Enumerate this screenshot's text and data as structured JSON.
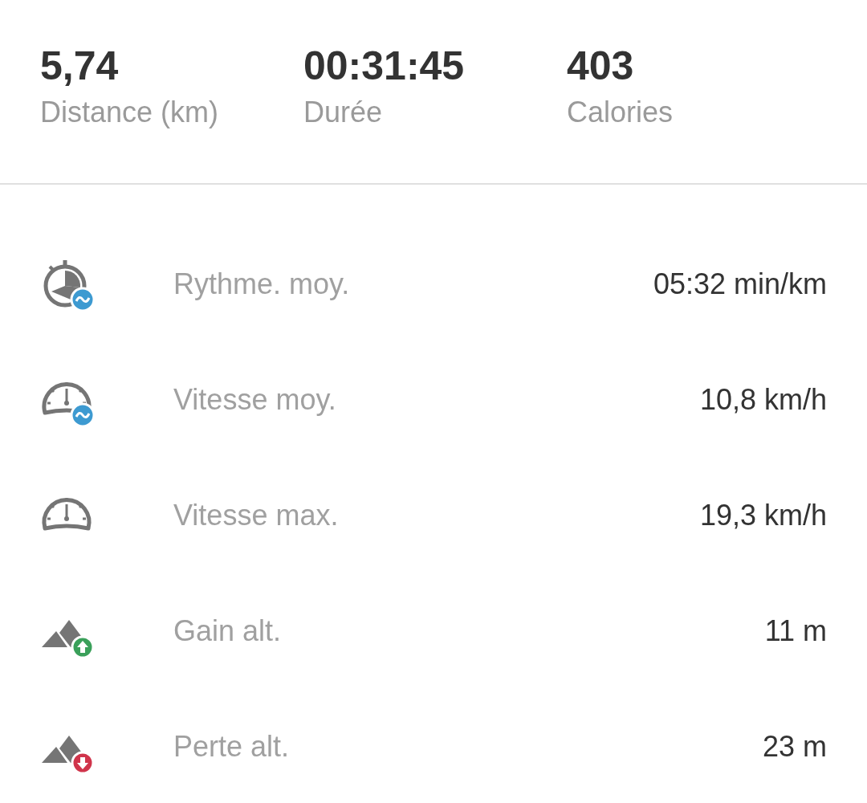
{
  "summary": [
    {
      "value": "5,74",
      "label": "Distance (km)"
    },
    {
      "value": "00:31:45",
      "label": "Durée"
    },
    {
      "value": "403",
      "label": "Calories"
    }
  ],
  "stats": [
    {
      "kind": "pace",
      "label": "Rythme. moy.",
      "value": "05:32 min/km"
    },
    {
      "kind": "avg-speed",
      "label": "Vitesse moy.",
      "value": "10,8 km/h"
    },
    {
      "kind": "max-speed",
      "label": "Vitesse max.",
      "value": "19,3 km/h"
    },
    {
      "kind": "gain",
      "label": "Gain alt.",
      "value": "11 m"
    },
    {
      "kind": "loss",
      "label": "Perte alt.",
      "value": "23 m"
    }
  ]
}
